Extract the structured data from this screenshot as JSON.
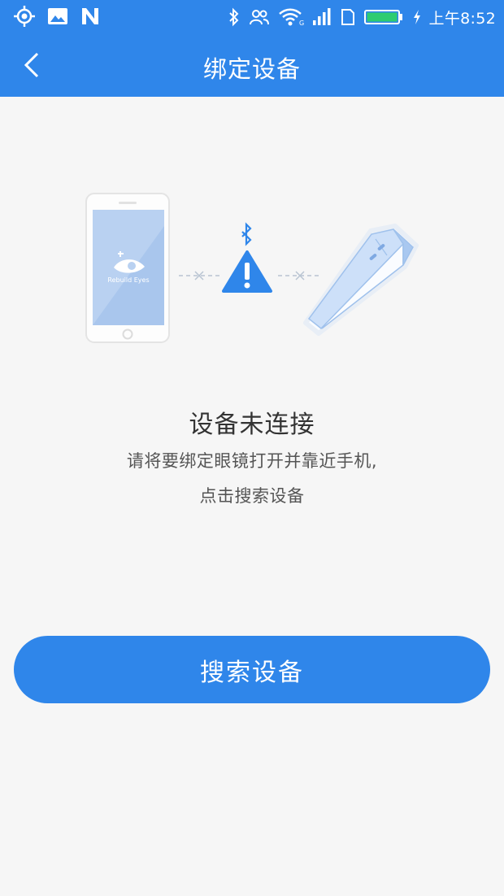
{
  "status_bar": {
    "time": "上午8:52",
    "left_icons": [
      "location-icon",
      "gallery-icon",
      "n-logo-icon"
    ],
    "right_icons": [
      "bluetooth-icon",
      "contacts-icon",
      "wifi-icon",
      "signal-icon",
      "sim-icon",
      "battery-icon"
    ]
  },
  "app_bar": {
    "title": "绑定设备",
    "back_icon": "back-chevron-icon"
  },
  "illustration": {
    "phone_logo_text": "Rebuild Eyes"
  },
  "content": {
    "status_title": "设备未连接",
    "hint_line1": "请将要绑定眼镜打开并靠近手机,",
    "hint_line2": "点击搜索设备"
  },
  "actions": {
    "search_button": "搜索设备"
  },
  "colors": {
    "primary": "#2f86ea",
    "background": "#f6f6f6",
    "battery": "#2ecc71"
  }
}
